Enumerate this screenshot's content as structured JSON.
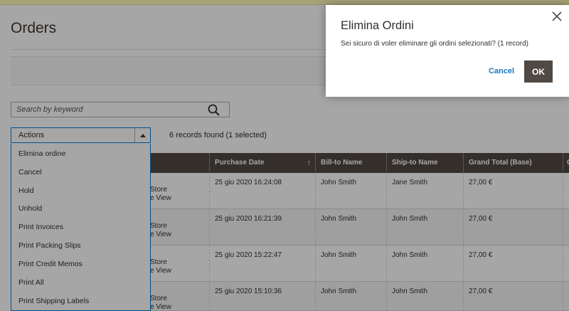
{
  "page": {
    "title": "Orders"
  },
  "search": {
    "placeholder": "Search by keyword"
  },
  "actions": {
    "label": "Actions",
    "records_found": "6 records found (1 selected)",
    "menu_items": [
      "Elimina ordine",
      "Cancel",
      "Hold",
      "Unhold",
      "Print Invoices",
      "Print Packing Slips",
      "Print Credit Memos",
      "Print All",
      "Print Shipping Labels"
    ]
  },
  "grid": {
    "columns": [
      "Purchase Date",
      "Bill-to Name",
      "Ship-to Name",
      "Grand Total (Base)",
      "G"
    ],
    "sort_arrow": "↑",
    "rows": [
      {
        "store": "Store",
        "view": "e View",
        "date": "25 giu 2020 16:24:08",
        "bill_to": "John Smith",
        "ship_to": "Jane Smith",
        "total": "27,00 €"
      },
      {
        "store": "Store",
        "view": "e View",
        "date": "25 giu 2020 16:21:39",
        "bill_to": "John Smith",
        "ship_to": "John Smith",
        "total": "27,00 €"
      },
      {
        "store": "Store",
        "view": "e View",
        "date": "25 giu 2020 15:22:47",
        "bill_to": "John Smith",
        "ship_to": "John Smith",
        "total": "27,00 €"
      },
      {
        "store": "Store",
        "view": "e View",
        "date": "25 giu 2020 15:10:36",
        "bill_to": "John Smith",
        "ship_to": "John Smith",
        "total": "27,00 €"
      }
    ]
  },
  "modal": {
    "title": "Elimina Ordini",
    "message": "Sei sicuro di voler eliminare gli ordini selezionati? (1 record)",
    "cancel_label": "Cancel",
    "ok_label": "OK",
    "close_icon": "close-icon"
  },
  "colors": {
    "header_bg": "#514943",
    "link_blue": "#1979c3",
    "focus_blue": "#007bdb"
  }
}
